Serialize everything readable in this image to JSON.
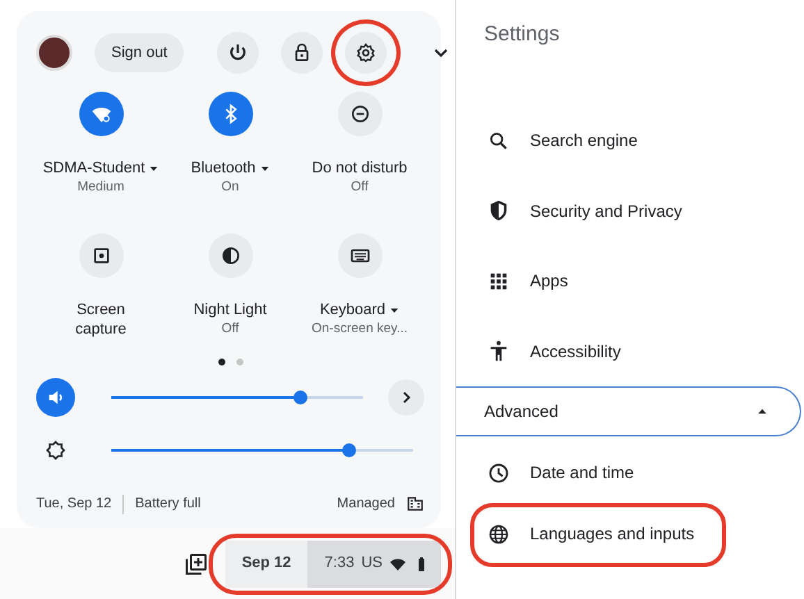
{
  "quick_settings": {
    "header": {
      "avatar": true,
      "sign_out": "Sign out",
      "buttons": [
        {
          "kind": "power",
          "annotated": false
        },
        {
          "kind": "lock",
          "annotated": false
        },
        {
          "kind": "settings",
          "annotated": true
        },
        {
          "kind": "collapse",
          "annotated": false
        }
      ]
    },
    "tiles": [
      {
        "kind": "wifi",
        "label": "SDMA-Student",
        "dropdown": true,
        "sub": "Medium",
        "on": true
      },
      {
        "kind": "bluetooth",
        "label": "Bluetooth",
        "dropdown": true,
        "sub": "On",
        "on": true
      },
      {
        "kind": "dnd",
        "label": "Do not disturb",
        "dropdown": false,
        "sub": "Off",
        "on": false
      },
      {
        "kind": "capture",
        "label": "Screen capture",
        "dropdown": false,
        "on": false
      },
      {
        "kind": "nightlight",
        "label": "Night Light",
        "dropdown": false,
        "sub": "Off",
        "on": false
      },
      {
        "kind": "keyboard",
        "label": "Keyboard",
        "dropdown": true,
        "sub": "On-screen key...",
        "on": false
      }
    ],
    "pages": [
      {
        "selected": true
      },
      {
        "selected": false
      }
    ],
    "sliders": [
      {
        "kind": "volume",
        "level": 0.75,
        "on": true,
        "more": true
      },
      {
        "kind": "brightness",
        "level": 0.79,
        "on": false,
        "more": false
      }
    ],
    "footer": {
      "date": "Tue, Sep 12",
      "battery": "Battery full",
      "managed": "Managed"
    }
  },
  "taskbar": {
    "date": "Sep 12",
    "time": "7:33",
    "ime": "US",
    "annotated": true
  },
  "settings": {
    "title": "Settings",
    "items": [
      {
        "kind": "search",
        "label": "Search engine",
        "annotated": false
      },
      {
        "kind": "shield",
        "label": "Security and Privacy",
        "annotated": false
      },
      {
        "kind": "apps",
        "label": "Apps",
        "annotated": false
      },
      {
        "kind": "accessibility",
        "label": "Accessibility",
        "annotated": false
      },
      {
        "kind": "section",
        "label": "Advanced",
        "expanded": true
      },
      {
        "kind": "clock",
        "label": "Date and time",
        "annotated": false
      },
      {
        "kind": "globe",
        "label": "Languages and inputs",
        "annotated": true
      }
    ]
  }
}
